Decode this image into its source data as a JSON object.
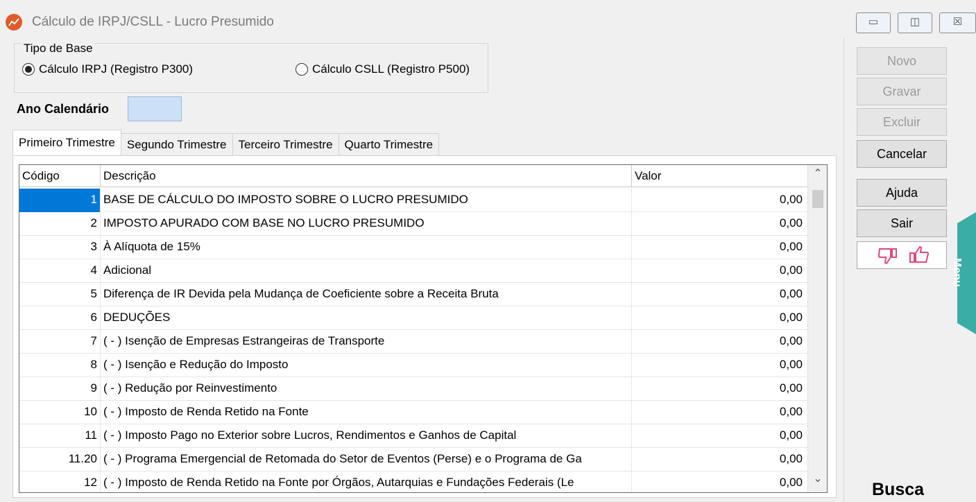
{
  "window": {
    "title": "Cálculo de IRPJ/CSLL - Lucro Presumido",
    "icon": "chart-app-icon",
    "controls": {
      "minimize": "▭",
      "maximize": "◫",
      "close": "☒"
    }
  },
  "tipo_base": {
    "legend": "Tipo de Base",
    "options": [
      {
        "label": "Cálculo IRPJ (Registro P300)",
        "selected": true
      },
      {
        "label": "Cálculo CSLL (Registro P500)",
        "selected": false
      }
    ]
  },
  "ano": {
    "label": "Ano Calendário",
    "value": ""
  },
  "tabs": [
    {
      "label": "Primeiro Trimestre",
      "active": true
    },
    {
      "label": "Segundo Trimestre",
      "active": false
    },
    {
      "label": "Terceiro Trimestre",
      "active": false
    },
    {
      "label": "Quarto Trimestre",
      "active": false
    }
  ],
  "grid": {
    "columns": [
      "Código",
      "Descrição",
      "Valor"
    ],
    "rows": [
      {
        "codigo": "1",
        "descricao": "BASE DE CÁLCULO DO IMPOSTO SOBRE O LUCRO PRESUMIDO",
        "valor": "0,00"
      },
      {
        "codigo": "2",
        "descricao": "IMPOSTO APURADO COM BASE NO LUCRO PRESUMIDO",
        "valor": "0,00"
      },
      {
        "codigo": "3",
        "descricao": "À Alíquota de 15%",
        "valor": "0,00"
      },
      {
        "codigo": "4",
        "descricao": "Adicional",
        "valor": "0,00"
      },
      {
        "codigo": "5",
        "descricao": "Diferença de IR Devida pela Mudança de Coeficiente sobre a Receita Bruta",
        "valor": "0,00"
      },
      {
        "codigo": "6",
        "descricao": "DEDUÇÕES",
        "valor": "0,00"
      },
      {
        "codigo": "7",
        "descricao": "( - ) Isenção de Empresas Estrangeiras de Transporte",
        "valor": "0,00"
      },
      {
        "codigo": "8",
        "descricao": "( - ) Isenção e Redução do Imposto",
        "valor": "0,00"
      },
      {
        "codigo": "9",
        "descricao": "( - ) Redução por Reinvestimento",
        "valor": "0,00"
      },
      {
        "codigo": "10",
        "descricao": "( - ) Imposto de Renda Retido na Fonte",
        "valor": "0,00"
      },
      {
        "codigo": "11",
        "descricao": "( - ) Imposto Pago no Exterior sobre Lucros, Rendimentos e Ganhos de Capital",
        "valor": "0,00"
      },
      {
        "codigo": "11.20",
        "descricao": "( - ) Programa Emergencial de Retomada do Setor de Eventos (Perse) e o Programa de Ga",
        "valor": "0,00"
      },
      {
        "codigo": "12",
        "descricao": "( - ) Imposto de Renda Retido na Fonte por Órgãos, Autarquias e Fundações Federais (Le",
        "valor": "0,00"
      }
    ],
    "selected_row": 0
  },
  "actions": {
    "novo": "Novo",
    "gravar": "Gravar",
    "excluir": "Excluir",
    "cancelar": "Cancelar",
    "ajuda": "Ajuda",
    "sair": "Sair"
  },
  "busca": "Busca",
  "menu": "Menu",
  "colors": {
    "selection": "#0078d7",
    "menu_tab": "#3aada6",
    "feedback_icons": "#e0457b",
    "ano_input": "#cce0f8"
  }
}
